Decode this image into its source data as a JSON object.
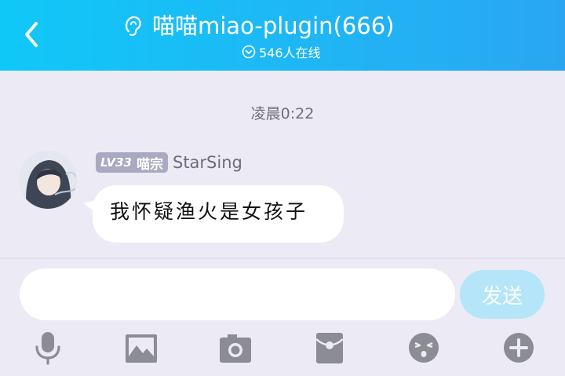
{
  "header": {
    "title": "喵喵miao-plugin(666)",
    "online_status": "546人在线"
  },
  "chat": {
    "timestamp": "凌晨0:22",
    "messages": [
      {
        "level_badge": "LV33",
        "title_badge": "喵宗",
        "sender": "StarSing",
        "text": "我怀疑渔火是女孩子"
      }
    ]
  },
  "composer": {
    "input_value": "",
    "send_label": "发送"
  },
  "toolbar": {
    "icons": [
      "microphone-icon",
      "image-icon",
      "camera-icon",
      "red-packet-icon",
      "emoji-icon",
      "plus-icon"
    ]
  },
  "colors": {
    "header_gradient_start": "#10c8f8",
    "header_gradient_end": "#2aa6f1",
    "background": "#eceaf4",
    "icon_gray": "#8c8c94",
    "send_button": "#b4e5f8",
    "badge": "#a9a9c1"
  }
}
